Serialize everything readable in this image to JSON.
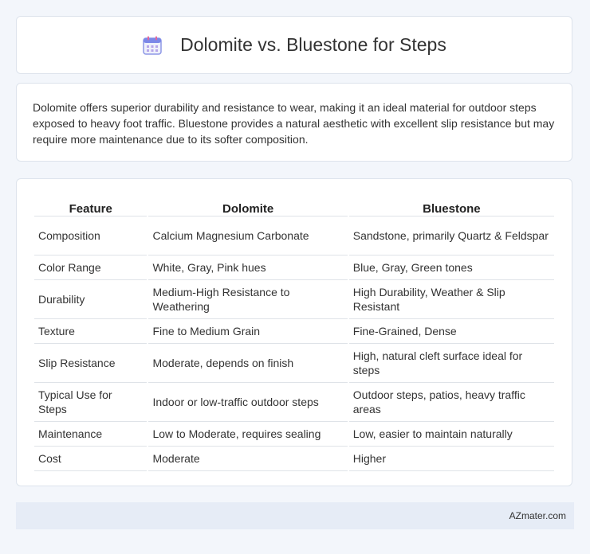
{
  "header": {
    "title": "Dolomite vs. Bluestone for Steps",
    "icon": "calendar-icon"
  },
  "summary": {
    "text": "Dolomite offers superior durability and resistance to wear, making it an ideal material for outdoor steps exposed to heavy foot traffic. Bluestone provides a natural aesthetic with excellent slip resistance but may require more maintenance due to its softer composition."
  },
  "table": {
    "headers": [
      "Feature",
      "Dolomite",
      "Bluestone"
    ],
    "rows": [
      [
        "Composition",
        "Calcium Magnesium Carbonate",
        "Sandstone, primarily Quartz & Feldspar"
      ],
      [
        "Color Range",
        "White, Gray, Pink hues",
        "Blue, Gray, Green tones"
      ],
      [
        "Durability",
        "Medium-High Resistance to Weathering",
        "High Durability, Weather & Slip Resistant"
      ],
      [
        "Texture",
        "Fine to Medium Grain",
        "Fine-Grained, Dense"
      ],
      [
        "Slip Resistance",
        "Moderate, depends on finish",
        "High, natural cleft surface ideal for steps"
      ],
      [
        "Typical Use for Steps",
        "Indoor or low-traffic outdoor steps",
        "Outdoor steps, patios, heavy traffic areas"
      ],
      [
        "Maintenance",
        "Low to Moderate, requires sealing",
        "Low, easier to maintain naturally"
      ],
      [
        "Cost",
        "Moderate",
        "Higher"
      ]
    ]
  },
  "footer": {
    "brand": "AZmater.com"
  }
}
